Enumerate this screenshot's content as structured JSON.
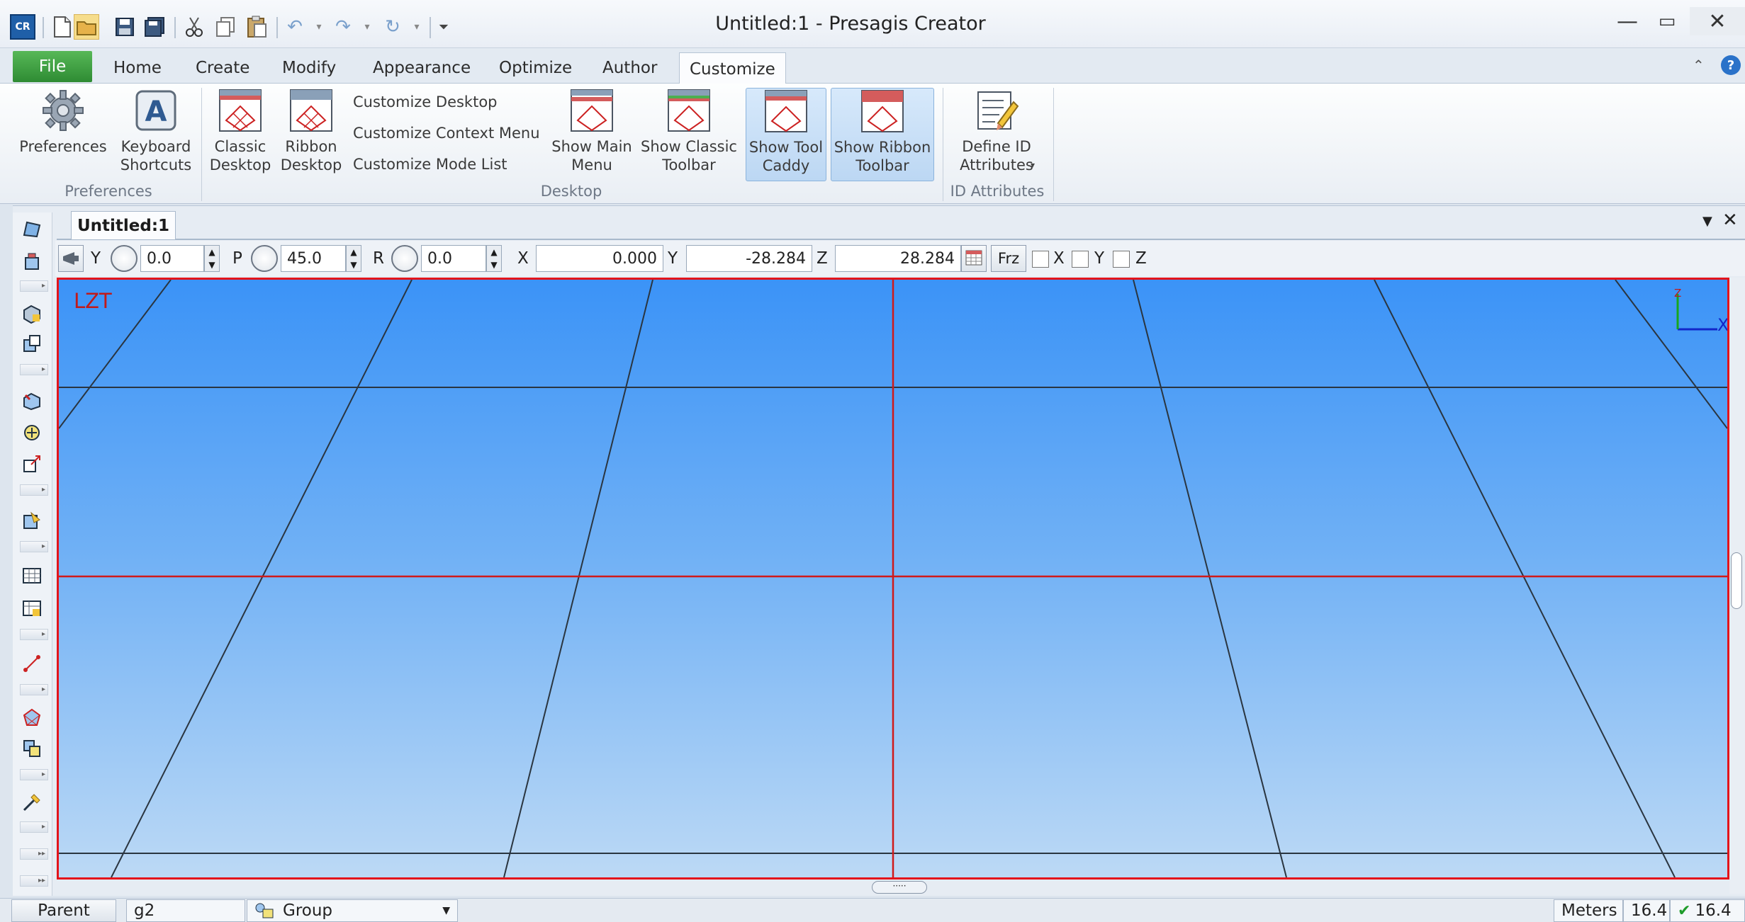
{
  "window": {
    "title": "Untitled:1 - Presagis Creator",
    "app_icon": "CR"
  },
  "ribbon": {
    "file_label": "File",
    "tabs": [
      "Home",
      "Create",
      "Modify",
      "Appearance",
      "Optimize",
      "Author",
      "Customize"
    ],
    "active_tab": "Customize",
    "groups": {
      "preferences": {
        "label": "Preferences",
        "buttons": [
          {
            "label": "Preferences",
            "icon": "gear-icon"
          },
          {
            "label": "Keyboard Shortcuts",
            "icon": "keyboard-a-icon"
          }
        ]
      },
      "desktop": {
        "label": "Desktop",
        "buttons": [
          {
            "label": "Classic Desktop",
            "icon": "desktop-grid-icon"
          },
          {
            "label": "Ribbon Desktop",
            "icon": "desktop-grid-icon"
          }
        ],
        "links": [
          "Customize Desktop",
          "Customize Context Menu",
          "Customize Mode List"
        ],
        "toggles": [
          {
            "label": "Show Main Menu",
            "pressed": false
          },
          {
            "label": "Show Classic Toolbar",
            "pressed": false
          },
          {
            "label": "Show Tool Caddy",
            "pressed": true
          },
          {
            "label": "Show Ribbon Toolbar",
            "pressed": true
          }
        ]
      },
      "id_attributes": {
        "label": "ID Attributes",
        "buttons": [
          {
            "label": "Define ID Attributes",
            "icon": "define-attributes-icon"
          }
        ]
      }
    }
  },
  "document": {
    "tab_title": "Untitled:1"
  },
  "coords": {
    "yaw_label": "Y",
    "yaw_value": "0.0",
    "pitch_label": "P",
    "pitch_value": "45.0",
    "roll_label": "R",
    "roll_value": "0.0",
    "x_label": "X",
    "x_value": "0.000",
    "y_label": "Y",
    "y_value": "-28.284",
    "z_label": "Z",
    "z_value": "28.284",
    "frz_label": "Frz",
    "lock_x_label": "X",
    "lock_y_label": "Y",
    "lock_z_label": "Z"
  },
  "viewport": {
    "view_name": "LZT",
    "axis_x_label": "X",
    "axis_z_label": "Z",
    "colors": {
      "sky_top": "#3b93f7",
      "sky_bottom": "#bcd9f5",
      "border": "#e3141b",
      "axis_lines": "#d01a1a",
      "grid_lines": "#2a3540"
    }
  },
  "statusbar": {
    "parent_label": "Parent",
    "parent_value": "g2",
    "type_value": "Group",
    "units": "Meters",
    "value_a": "16.4",
    "value_b": "16.4"
  }
}
